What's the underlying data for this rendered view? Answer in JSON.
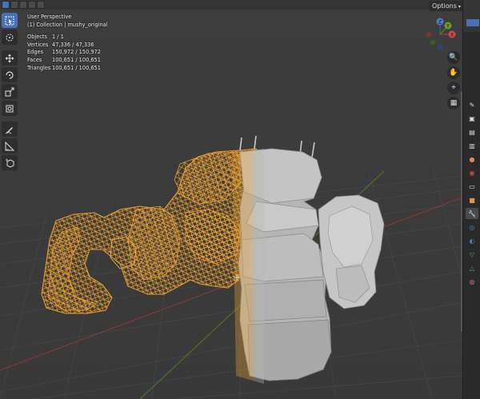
{
  "header": {
    "options_label": "Options"
  },
  "overlay": {
    "perspective": "User Perspective",
    "collection": "(1) Collection | mushy_original",
    "stats": [
      {
        "label": "Objects",
        "value": "1 / 1"
      },
      {
        "label": "Vertices",
        "value": "47,336 / 47,336"
      },
      {
        "label": "Edges",
        "value": "150,972 / 150,972"
      },
      {
        "label": "Faces",
        "value": "100,651 / 100,651"
      },
      {
        "label": "Triangles",
        "value": "100,651 / 100,651"
      }
    ]
  },
  "gizmo": {
    "x_label": "X",
    "y_label": "Y",
    "z_label": "Z"
  },
  "toolbar": {
    "tools": [
      "select-box-icon",
      "cursor-icon",
      "move-icon",
      "rotate-icon",
      "scale-icon",
      "transform-icon",
      "annotate-icon",
      "measure-icon",
      "add-cube-icon"
    ]
  },
  "nav": [
    "zoom-icon",
    "hand-pan-icon",
    "camera-icon",
    "grid-view-icon"
  ],
  "colors": {
    "viewport_bg": "#3c3c3c",
    "wire_orange": "#f0a030",
    "mesh_gray": "#b8b8b8",
    "axis_red": "#b03b3b",
    "axis_green": "#5a8a2a",
    "active_blue": "#4772b3"
  }
}
